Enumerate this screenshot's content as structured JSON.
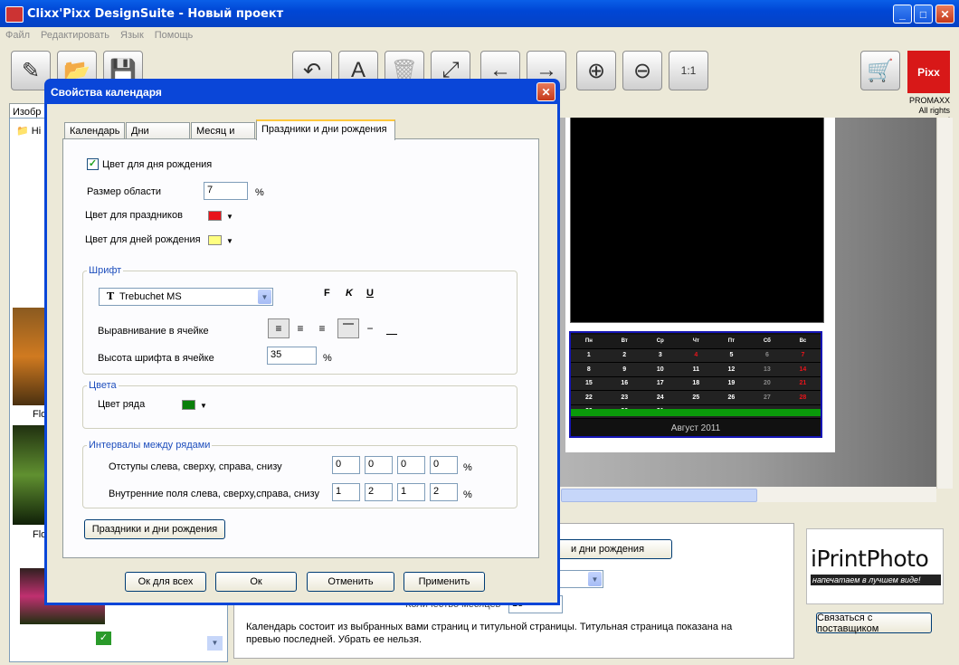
{
  "window": {
    "title": "Clixx'Pixx DesignSuite - Новый проект",
    "min": "_",
    "max": "□",
    "close": "✕"
  },
  "menu": [
    "Файл",
    "Редактировать",
    "Язык",
    "Помощь"
  ],
  "brand": {
    "logo_text": "Pixx",
    "company": "PROMAXX",
    "rights": "All rights reserved"
  },
  "left_panel": {
    "tab_label": "Изобр",
    "tree_root": "Hi",
    "thumb_captions": [
      "Flo",
      "Flo"
    ]
  },
  "preview": {
    "weekdays": [
      "Пн",
      "Вт",
      "Ср",
      "Чт",
      "Пт",
      "Сб",
      "Вс"
    ],
    "weeks": [
      [
        "1",
        "2",
        "3",
        "4",
        "5",
        "6",
        "7"
      ],
      [
        "8",
        "9",
        "10",
        "11",
        "12",
        "13",
        "14"
      ],
      [
        "15",
        "16",
        "17",
        "18",
        "19",
        "20",
        "21"
      ],
      [
        "22",
        "23",
        "24",
        "25",
        "26",
        "27",
        "28"
      ],
      [
        "29",
        "30",
        "31",
        "",
        "",
        "",
        ""
      ]
    ],
    "month_label": "Август 2011",
    "holiday_color": "#e8141b",
    "weekend_color": "#888888"
  },
  "bottom_panel": {
    "button_label": "и дни рождения",
    "count_label": "Количество месяцев",
    "count_value": "13",
    "info_text": "Календарь состоит из выбранных вами страниц и титульной страницы. Титульная страница показана на превью последней. Убрать ее нельзя."
  },
  "iprint": {
    "logo_text": "iPrintPhoto",
    "slogan": "напечатаем в лучшем виде!",
    "contact_button": "Связаться с поставщиком"
  },
  "dialog": {
    "title": "Свойства календаря",
    "tabs": [
      "Календарь",
      "Дни недели",
      "Месяц и год",
      "Праздники и дни рождения"
    ],
    "birthday_color_label": "Цвет для дня рождения",
    "birthday_checked": true,
    "area_size_label": "Размер области",
    "area_size_value": "7",
    "percent": "%",
    "holidays_color_label": "Цвет для праздников",
    "holidays_color": "#e8141b",
    "birthdays_color_label": "Цвет для дней рождения",
    "birthdays_color": "#ffff80",
    "font_group": "Шрифт",
    "font_name": "Trebuchet MS",
    "font_buttons": {
      "bold": "F",
      "italic": "K",
      "underline": "U"
    },
    "align_label": "Выравнивание в ячейке",
    "font_height_label": "Высота шрифта в ячейке",
    "font_height_value": "35",
    "colors_group": "Цвета",
    "row_color_label": "Цвет ряда",
    "row_color": "#0a7f0a",
    "intervals_group": "Интервалы между рядами",
    "margins_label": "Отступы слева, сверху, справа, снизу",
    "margins": [
      "0",
      "0",
      "0",
      "0"
    ],
    "paddings_label": "Внутренние поля слева, сверху,справа, снизу",
    "paddings": [
      "1",
      "2",
      "1",
      "2"
    ],
    "holidays_button": "Праздники и дни рождения",
    "buttons": {
      "ok_all": "Ок для всех",
      "ok": "Ок",
      "cancel": "Отменить",
      "apply": "Применить"
    }
  }
}
